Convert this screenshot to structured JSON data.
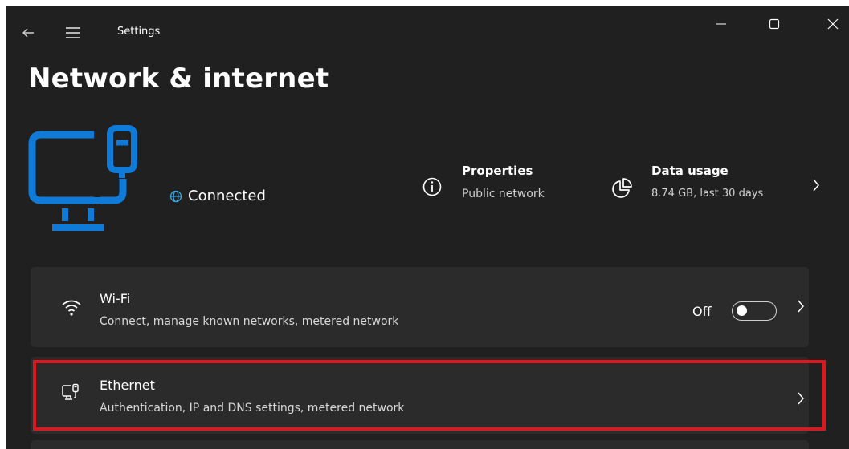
{
  "window": {
    "title": "Settings",
    "icons": {
      "back": "back-arrow-icon",
      "menu": "hamburger-menu-icon",
      "minimize": "minimize-icon",
      "maximize": "maximize-icon",
      "close": "close-icon"
    }
  },
  "page": {
    "title": "Network & internet"
  },
  "hero": {
    "icon": "ethernet-computer-icon",
    "accent_color": "#0f7ad8",
    "status_icon": "globe-icon",
    "status_text": "Connected",
    "properties": {
      "icon": "info-icon",
      "title": "Properties",
      "subtitle": "Public network"
    },
    "data_usage": {
      "icon": "pie-chart-icon",
      "title": "Data usage",
      "subtitle": "8.74 GB, last 30 days"
    }
  },
  "cards": {
    "wifi": {
      "icon": "wifi-icon",
      "title": "Wi-Fi",
      "subtitle": "Connect, manage known networks, metered network",
      "toggle_label": "Off",
      "toggle_state": false
    },
    "ethernet": {
      "icon": "ethernet-icon",
      "title": "Ethernet",
      "subtitle": "Authentication, IP and DNS settings, metered network",
      "highlight_color": "#e0161e"
    }
  }
}
